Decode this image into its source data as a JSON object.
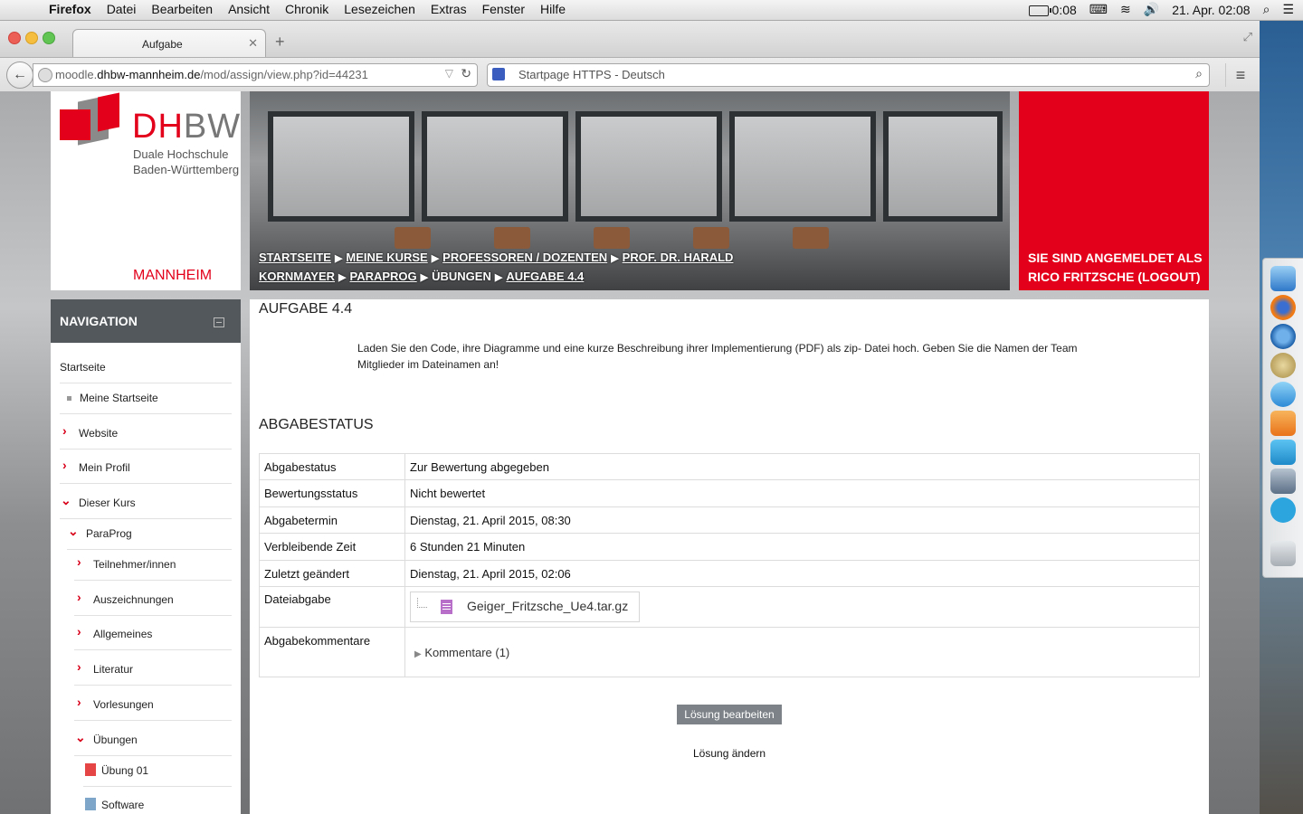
{
  "menubar": {
    "app": "Firefox",
    "items": [
      "Datei",
      "Bearbeiten",
      "Ansicht",
      "Chronik",
      "Lesezeichen",
      "Extras",
      "Fenster",
      "Hilfe"
    ],
    "battery": "0:08",
    "datetime": "21. Apr. 02:08"
  },
  "browser": {
    "tab_title": "Aufgabe",
    "url_prefix": "moodle.",
    "url_domain": "dhbw-mannheim.de",
    "url_path": "/mod/assign/view.php?id=44231",
    "search_placeholder": "Startpage HTTPS - Deutsch"
  },
  "header": {
    "logo_dh": "DH",
    "logo_bw": "BW",
    "logo_line1": "Duale Hochschule",
    "logo_line2": "Baden-Württemberg",
    "logo_city": "MANNHEIM",
    "breadcrumb": [
      "Startseite",
      "Meine Kurse",
      "Professoren / Dozenten",
      "Prof. Dr. Harald Kornmayer",
      "ParaProg",
      "Übungen",
      "Aufgabe 4.4"
    ],
    "login_text": "SIE SIND ANGEMELDET ALS RICO FRITZSCHE (LOGOUT)"
  },
  "navigation": {
    "title": "NAVIGATION",
    "items": [
      {
        "label": "Startseite"
      },
      {
        "label": "Meine Startseite"
      },
      {
        "label": "Website"
      },
      {
        "label": "Mein Profil"
      },
      {
        "label": "Dieser Kurs"
      },
      {
        "label": "ParaProg"
      },
      {
        "label": "Teilnehmer/innen"
      },
      {
        "label": "Auszeichnungen"
      },
      {
        "label": "Allgemeines"
      },
      {
        "label": "Literatur"
      },
      {
        "label": "Vorlesungen"
      },
      {
        "label": "Übungen"
      },
      {
        "label": "Übung 01"
      },
      {
        "label": "Software"
      }
    ]
  },
  "main": {
    "title": "AUFGABE 4.4",
    "description": "Laden Sie den Code, ihre Diagramme und eine kurze Beschreibung ihrer Implementierung (PDF) als zip- Datei hoch. Geben Sie die Namen der Team Mitglieder im Dateinamen an!",
    "status_heading": "ABGABESTATUS",
    "rows": [
      {
        "key": "Abgabestatus",
        "value": "Zur Bewertung abgegeben"
      },
      {
        "key": "Bewertungsstatus",
        "value": "Nicht bewertet"
      },
      {
        "key": "Abgabetermin",
        "value": "Dienstag, 21. April 2015, 08:30"
      },
      {
        "key": "Verbleibende Zeit",
        "value": "6 Stunden 21 Minuten"
      },
      {
        "key": "Zuletzt geändert",
        "value": "Dienstag, 21. April 2015, 02:06"
      },
      {
        "key": "Dateiabgabe",
        "value": "Geiger_Fritzsche_Ue4.tar.gz"
      },
      {
        "key": "Abgabekommentare",
        "value": "Kommentare (1)"
      }
    ],
    "edit_button": "Lösung bearbeiten",
    "change_text": "Lösung ändern"
  }
}
